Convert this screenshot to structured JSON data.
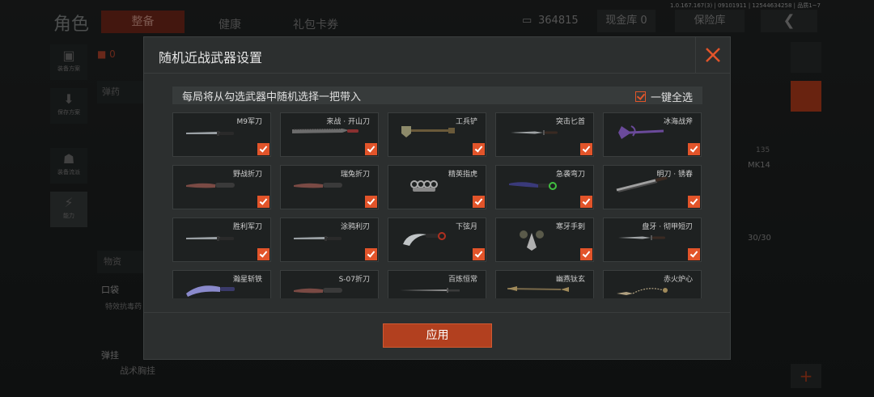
{
  "version_info": "1.0.167.167(3) | 09101911 | 12544634258 | 品质1~7",
  "background": {
    "title": "角色",
    "tabs": [
      "整备",
      "健康",
      "礼包卡券"
    ],
    "currency_value": "364815",
    "cash_label": "现金库 0",
    "safe_label": "保险库",
    "back_icon": "chevron-left-icon",
    "left_nav": [
      "装备方案",
      "保存方案",
      "装备流派",
      "能力"
    ],
    "ammo_count": "0",
    "section_ammo": "弹药",
    "section_items": "物资",
    "pocket_label": "口袋",
    "pocket_item": "特效抗毒药",
    "rig_label": "弹挂",
    "rig_item": "战术胸挂",
    "right_labels": {
      "weapon": "MK14",
      "count": "135",
      "ammo": "30/30"
    }
  },
  "modal": {
    "title": "随机近战武器设置",
    "close_icon": "close-icon",
    "info_text": "每局将从勾选武器中随机选择一把带入",
    "select_all_label": "一键全选",
    "apply_label": "应用",
    "accent": "#e2542a",
    "weapons": [
      {
        "name": "M9军刀",
        "checked": true,
        "icon": "knife-icon"
      },
      {
        "name": "来战 · 开山刀",
        "checked": true,
        "icon": "machete-icon"
      },
      {
        "name": "工兵铲",
        "checked": true,
        "icon": "shovel-icon"
      },
      {
        "name": "突击匕首",
        "checked": true,
        "icon": "dagger-icon"
      },
      {
        "name": "冰海战斧",
        "checked": true,
        "icon": "axe-icon"
      },
      {
        "name": "野战折刀",
        "checked": true,
        "icon": "folding-knife-icon"
      },
      {
        "name": "瑞兔折刀",
        "checked": true,
        "icon": "folding-knife-icon"
      },
      {
        "name": "精英指虎",
        "checked": true,
        "icon": "knuckles-icon"
      },
      {
        "name": "急袭弯刀",
        "checked": true,
        "icon": "curved-blade-icon"
      },
      {
        "name": "明刀 · 锈春",
        "checked": true,
        "icon": "blade-icon"
      },
      {
        "name": "胜利军刀",
        "checked": true,
        "icon": "knife-icon"
      },
      {
        "name": "涂鸦利刃",
        "checked": true,
        "icon": "knife-icon"
      },
      {
        "name": "下弦月",
        "checked": true,
        "icon": "karambit-icon"
      },
      {
        "name": "寒牙手刺",
        "checked": true,
        "icon": "push-dagger-icon"
      },
      {
        "name": "盘牙 · 彻甲短刃",
        "checked": true,
        "icon": "dagger-icon"
      },
      {
        "name": "瀚星斩铁",
        "checked": false,
        "icon": "cleaver-icon"
      },
      {
        "name": "S-07折刀",
        "checked": false,
        "icon": "folding-knife-icon"
      },
      {
        "name": "百炼恒常",
        "checked": false,
        "icon": "sword-icon"
      },
      {
        "name": "幽燕钛玄",
        "checked": false,
        "icon": "spear-icon"
      },
      {
        "name": "赤火炉心",
        "checked": false,
        "icon": "chain-blade-icon"
      }
    ]
  }
}
